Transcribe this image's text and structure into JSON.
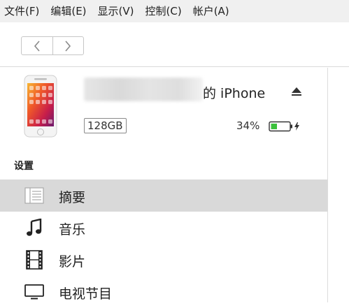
{
  "menubar": {
    "items": [
      {
        "label": "文件(F)"
      },
      {
        "label": "编辑(E)"
      },
      {
        "label": "显示(V)"
      },
      {
        "label": "控制(C)"
      },
      {
        "label": "帐户(A)"
      }
    ]
  },
  "toolbar": {
    "back_icon": "chevron-left-icon",
    "forward_icon": "chevron-right-icon"
  },
  "device": {
    "name_suffix": "的 iPhone",
    "capacity": "128GB",
    "battery_percent": "34%",
    "battery_level": 0.34,
    "battery_color": "#3cc13c",
    "eject_icon": "eject-icon",
    "charging_icon": "charging-bolt-icon"
  },
  "sidebar": {
    "section_title": "设置",
    "items": [
      {
        "label": "摘要",
        "icon": "summary-list-icon",
        "selected": true
      },
      {
        "label": "音乐",
        "icon": "music-note-icon",
        "selected": false
      },
      {
        "label": "影片",
        "icon": "film-icon",
        "selected": false
      },
      {
        "label": "电视节目",
        "icon": "tv-icon",
        "selected": false
      }
    ]
  }
}
